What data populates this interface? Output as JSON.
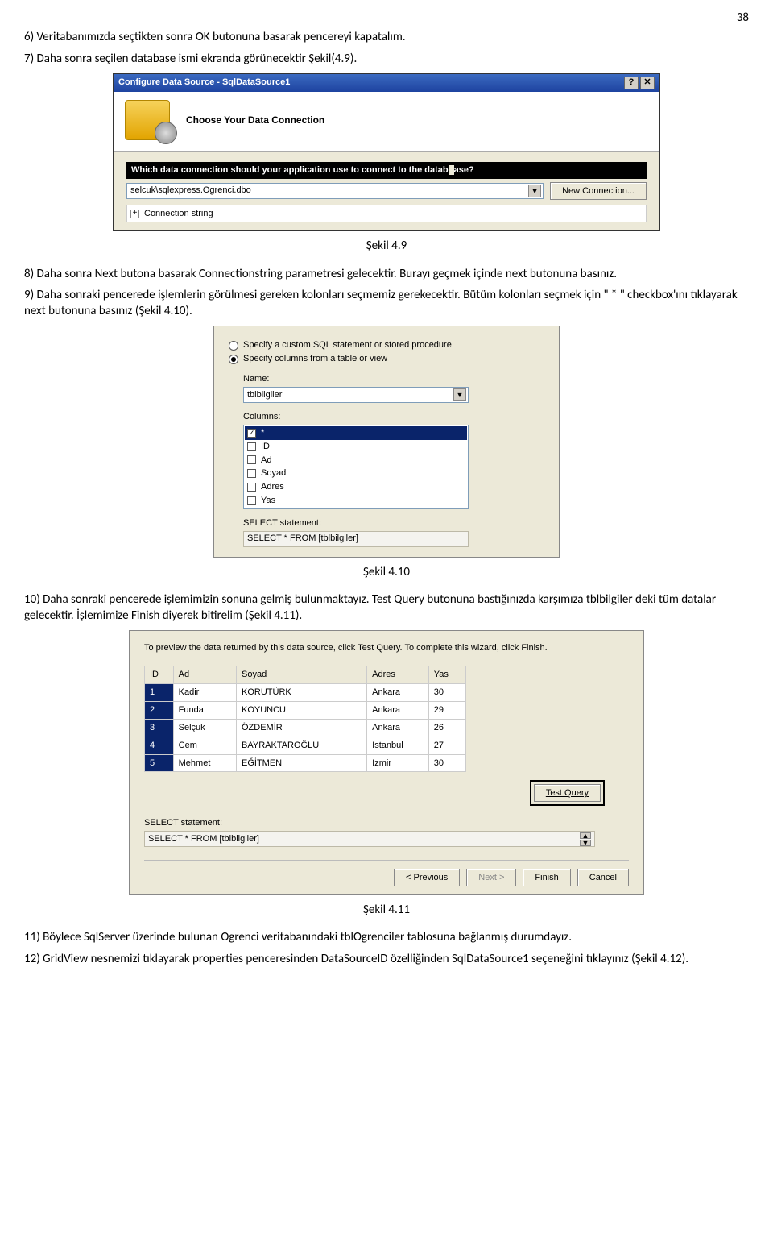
{
  "page_number": "38",
  "p1": "6)   Veritabanımızda seçtikten sonra OK butonuna basarak pencereyi kapatalım.",
  "p2": "7)   Daha sonra seçilen database ismi ekranda görünecektir Şekil(4.9).",
  "dlg1": {
    "title": "Configure Data Source - SqlDataSource1",
    "help": "?",
    "close": "✕",
    "heading": "Choose Your Data Connection",
    "question_a": "Which data connection should your application use to connect to the datab",
    "question_b": "ase?",
    "dropdown_value": "selcuk\\sqlexpress.Ogrenci.dbo",
    "new_conn_btn": "New Connection...",
    "conn_str": "Connection string",
    "plus": "+"
  },
  "cap1": "Şekil 4.9",
  "p3": "8)   Daha sonra Next butona basarak Connectionstring parametresi gelecektir. Burayı geçmek içinde next butonuna basınız.",
  "p4": "9)   Daha sonraki pencerede işlemlerin görülmesi gereken kolonları seçmemiz gerekecektir. Bütüm kolonları seçmek için  \" * \" checkbox'ını tıklayarak next butonuna basınız (Şekil 4.10).",
  "dlg2": {
    "r1": "Specify a custom SQL statement or stored procedure",
    "r2": "Specify columns from a table or view",
    "lbl_name": "Name:",
    "name_val": "tblbilgiler",
    "lbl_cols": "Columns:",
    "cols": [
      "*",
      "ID",
      "Ad",
      "Soyad",
      "Adres",
      "Yas"
    ],
    "lbl_sel": "SELECT statement:",
    "sel_val": "SELECT * FROM [tblbilgiler]"
  },
  "cap2": "Şekil 4.10",
  "p5": "10) Daha sonraki pencerede işlemimizin sonuna gelmiş bulunmaktayız. Test Query butonuna bastığınızda karşımıza tblbilgiler deki tüm datalar gelecektir. İşlemimize Finish diyerek bitirelim (Şekil 4.11).",
  "dlg3": {
    "instr": "To preview the data returned by this data source, click Test Query. To complete this wizard, click Finish.",
    "cols": [
      "ID",
      "Ad",
      "Soyad",
      "Adres",
      "Yas"
    ],
    "rows": [
      [
        "1",
        "Kadir",
        "KORUTÜRK",
        "Ankara",
        "30"
      ],
      [
        "2",
        "Funda",
        "KOYUNCU",
        "Ankara",
        "29"
      ],
      [
        "3",
        "Selçuk",
        "ÖZDEMİR",
        "Ankara",
        "26"
      ],
      [
        "4",
        "Cem",
        "BAYRAKTAROĞLU",
        "Istanbul",
        "27"
      ],
      [
        "5",
        "Mehmet",
        "EĞİTMEN",
        "Izmir",
        "30"
      ]
    ],
    "test_btn": "Test Query",
    "lbl_sel": "SELECT statement:",
    "sel_val": "SELECT * FROM [tblbilgiler]",
    "prev": "< Previous",
    "next": "Next >",
    "finish": "Finish",
    "cancel": "Cancel"
  },
  "cap3": "Şekil 4.11",
  "p6": "11) Böylece SqlServer üzerinde bulunan Ogrenci veritabanındaki tblOgrenciler tablosuna bağlanmış durumdayız.",
  "p7": "12) GridView nesnemizi tıklayarak properties penceresinden DataSourceID özelliğinden SqlDataSource1 seçeneğini tıklayınız (Şekil 4.12)."
}
